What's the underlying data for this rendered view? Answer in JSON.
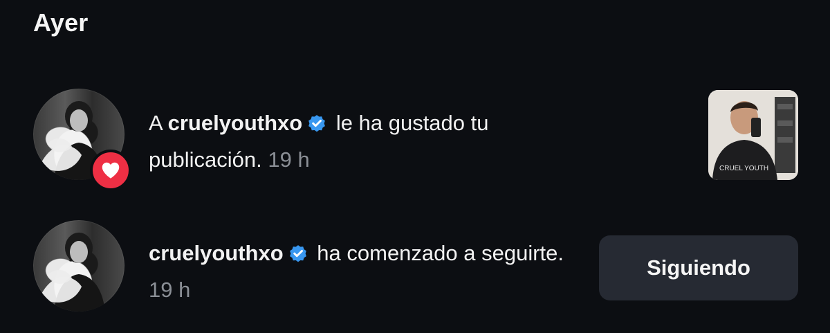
{
  "section": {
    "title": "Ayer"
  },
  "notifications": [
    {
      "prefix": "A",
      "username": "cruelyouthxo",
      "action": "le ha gustado tu publicación.",
      "time": "19 h",
      "badge": "heart-icon",
      "badge_color": "#ee2f44",
      "thumbnail_text": "CRUEL YOUTH"
    },
    {
      "username": "cruelyouthxo",
      "action": "ha comenzado a seguirte.",
      "time": "19 h",
      "button_label": "Siguiendo"
    }
  ],
  "colors": {
    "background": "#0c0e12",
    "verified": "#3897f0",
    "button_bg": "#262a33",
    "secondary_text": "#8b8f96"
  }
}
